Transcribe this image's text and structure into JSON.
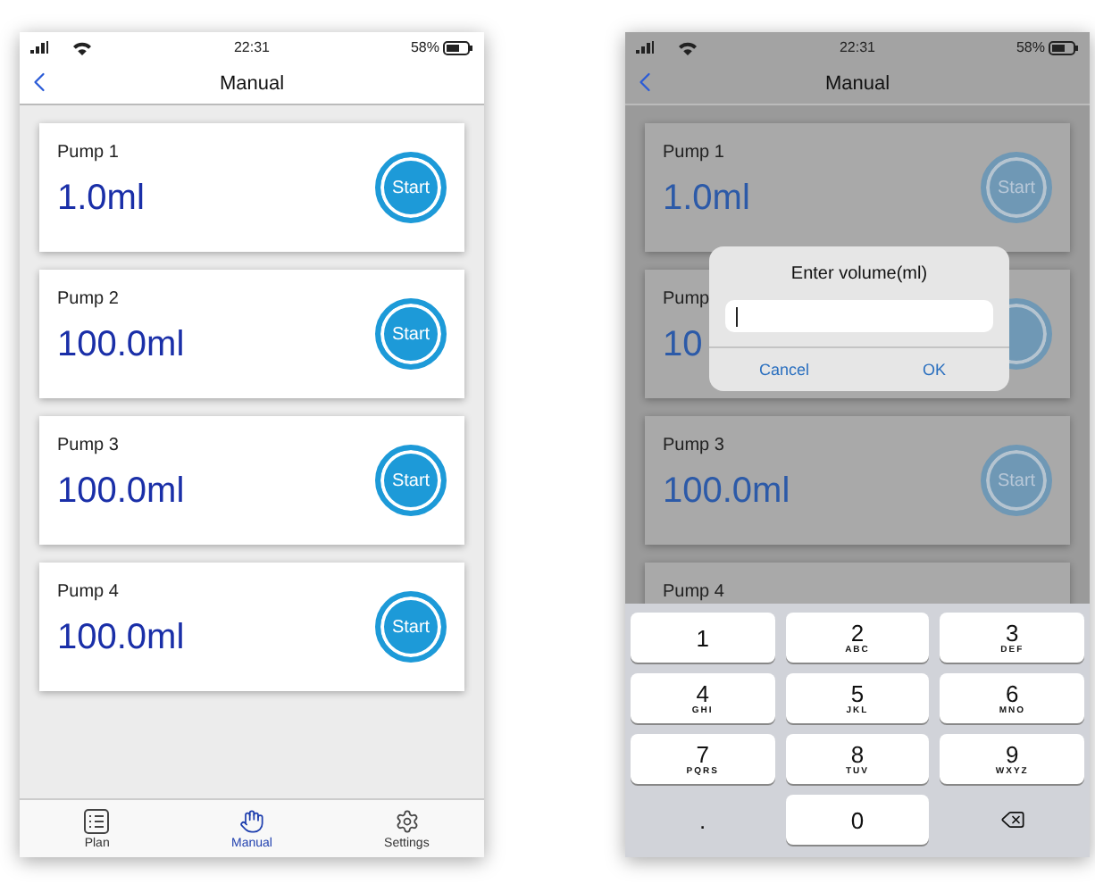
{
  "screens": [
    {
      "dimmed": false,
      "status_bar": {
        "time": "22:31",
        "battery": "58%"
      },
      "nav_title": "Manual",
      "pumps": [
        {
          "label": "Pump 1",
          "volume": "1.0ml",
          "start": "Start"
        },
        {
          "label": "Pump 2",
          "volume": "100.0ml",
          "start": "Start"
        },
        {
          "label": "Pump 3",
          "volume": "100.0ml",
          "start": "Start"
        },
        {
          "label": "Pump 4",
          "volume": "100.0ml",
          "start": "Start"
        }
      ],
      "tab_bar": [
        {
          "label": "Plan",
          "selected": false
        },
        {
          "label": "Manual",
          "selected": true
        },
        {
          "label": "Settings",
          "selected": false
        }
      ]
    },
    {
      "dimmed": true,
      "status_bar": {
        "time": "22:31",
        "battery": "58%"
      },
      "nav_title": "Manual",
      "pumps": [
        {
          "label": "Pump 1",
          "volume": "1.0ml",
          "start": "Start"
        },
        {
          "label": "Pump",
          "volume": "10"
        },
        {
          "label": "Pump 3",
          "volume": "100.0ml",
          "start": "Start"
        },
        {
          "label": "Pump 4"
        }
      ],
      "dialog": {
        "title": "Enter volume(ml)",
        "buttons": [
          "Cancel",
          "OK"
        ]
      },
      "keypad": [
        {
          "kind": "key",
          "digit": "1"
        },
        {
          "kind": "key",
          "digit": "2",
          "letters": "ABC"
        },
        {
          "kind": "key",
          "digit": "3",
          "letters": "DEF"
        },
        {
          "kind": "key",
          "digit": "4",
          "letters": "GHI"
        },
        {
          "kind": "key",
          "digit": "5",
          "letters": "JKL"
        },
        {
          "kind": "key",
          "digit": "6",
          "letters": "MNO"
        },
        {
          "kind": "key",
          "digit": "7",
          "letters": "PQRS"
        },
        {
          "kind": "key",
          "digit": "8",
          "letters": "TUV"
        },
        {
          "kind": "key",
          "digit": "9",
          "letters": "WXYZ"
        },
        {
          "kind": "plain",
          "digit": "."
        },
        {
          "kind": "key",
          "digit": "0"
        },
        {
          "kind": "delete"
        }
      ]
    }
  ]
}
